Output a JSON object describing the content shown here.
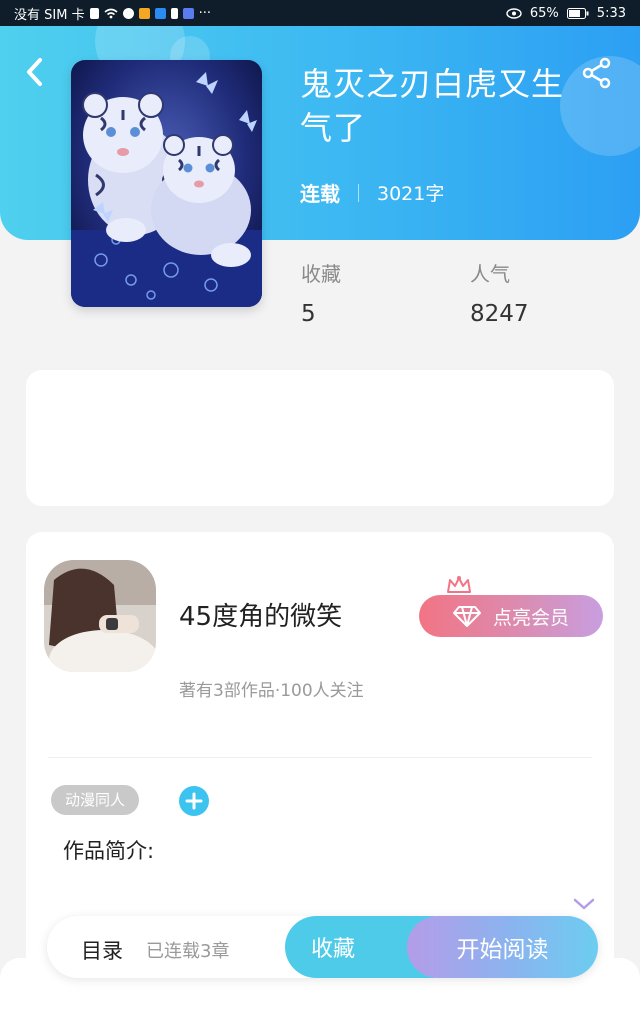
{
  "status_bar": {
    "carrier": "没有 SIM 卡",
    "battery": "65%",
    "time": "5:33"
  },
  "book": {
    "title": "鬼灭之刃白虎又生气了",
    "status": "连载",
    "word_count": "3021字",
    "cover_icon": "white-tiger-cubs-image"
  },
  "stats": {
    "favorites_label": "收藏",
    "favorites_value": "5",
    "popularity_label": "人气",
    "popularity_value": "8247"
  },
  "author": {
    "name": "45度角的微笑",
    "subtitle": "著有3部作品·100人关注",
    "vip_label": "点亮会员"
  },
  "tags": [
    "动漫同人"
  ],
  "intro_label": "作品简介:",
  "bottom_bar": {
    "toc_label": "目录",
    "chapters_label": "已连载3章",
    "collect_label": "收藏",
    "read_label": "开始阅读"
  },
  "colors": {
    "header_start": "#4fd0ee",
    "header_end": "#2c9ff3",
    "accent": "#3cc3ef",
    "vip_start": "#f27484",
    "vip_end": "#c89ee0"
  }
}
